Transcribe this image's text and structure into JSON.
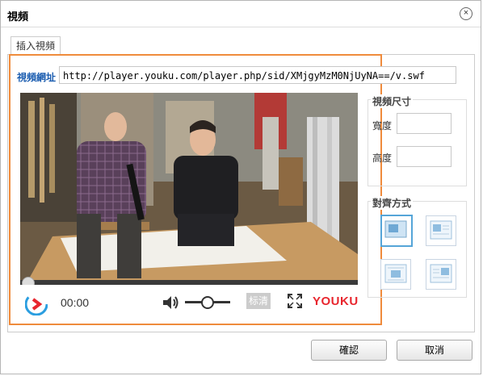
{
  "dialog": {
    "title": "視頻",
    "close_label": "×",
    "tab_label": "插入視頻",
    "url_label": "視頻網址",
    "url_value": "http://player.youku.com/player.php/sid/XMjgyMzM0NjUyNA==/v.swf"
  },
  "player": {
    "time": "00:00",
    "quality_label": "标清",
    "logo_text": "YOUKU",
    "progress": 0
  },
  "size_group": {
    "title": "視頻尺寸",
    "width_label": "寬度",
    "height_label": "高度",
    "width_value": "",
    "height_value": ""
  },
  "align_group": {
    "title": "對齊方式",
    "options": [
      "default",
      "left",
      "center",
      "right"
    ],
    "selected": "default"
  },
  "buttons": {
    "ok": "確認",
    "cancel": "取消"
  },
  "colors": {
    "accent_border": "#ef8b3c",
    "label_blue": "#1b5db0",
    "youku_red": "#e8262e"
  }
}
